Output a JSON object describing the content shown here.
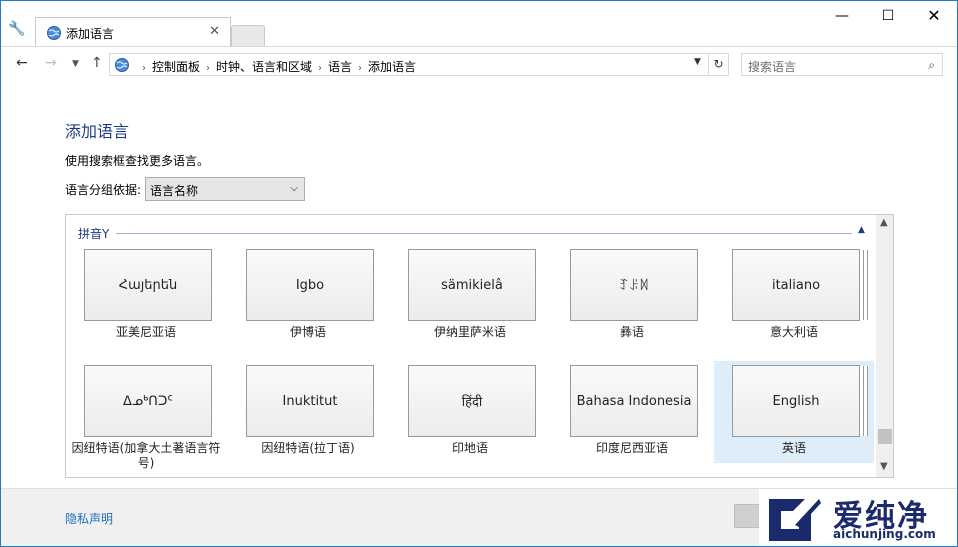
{
  "window": {
    "tab_title": "添加语言",
    "controls": {
      "minimize": "—",
      "maximize": "☐",
      "close": "✕"
    }
  },
  "nav": {
    "breadcrumbs": [
      "控制面板",
      "时钟、语言和区域",
      "语言",
      "添加语言"
    ],
    "search_placeholder": "搜索语言"
  },
  "page": {
    "title": "添加语言",
    "description": "使用搜索框查找更多语言。",
    "group_by_label": "语言分组依据:",
    "group_by_value": "语言名称"
  },
  "group": {
    "header": "拼音Y"
  },
  "tiles": [
    {
      "native": "Հայերեն",
      "name": "亚美尼亚语",
      "stack": false,
      "selected": false
    },
    {
      "native": "Igbo",
      "name": "伊博语",
      "stack": false,
      "selected": false
    },
    {
      "native": "sämikielâ",
      "name": "伊纳里萨米语",
      "stack": false,
      "selected": false
    },
    {
      "native": "ꆈꌠꉙ",
      "name": "彝语",
      "stack": false,
      "selected": false
    },
    {
      "native": "italiano",
      "name": "意大利语",
      "stack": true,
      "selected": false
    },
    {
      "native": "ᐃᓄᒃᑎᑐᑦ",
      "name": "因纽特语(加拿大土著语言符号)",
      "stack": false,
      "selected": false
    },
    {
      "native": "Inuktitut",
      "name": "因纽特语(拉丁语)",
      "stack": false,
      "selected": false
    },
    {
      "native": "हिंदी",
      "name": "印地语",
      "stack": false,
      "selected": false
    },
    {
      "native": "Bahasa Indonesia",
      "name": "印度尼西亚语",
      "stack": false,
      "selected": false
    },
    {
      "native": "English",
      "name": "英语",
      "stack": true,
      "selected": true
    }
  ],
  "footer": {
    "privacy_link": "隐私声明"
  },
  "watermark": {
    "brand": "爱纯净",
    "url": "aichunjing.com"
  },
  "colors": {
    "accent": "#1e3a87",
    "link": "#1f6dbd",
    "selected_tile": "#deedfa",
    "window_border": "#2b78c5"
  }
}
